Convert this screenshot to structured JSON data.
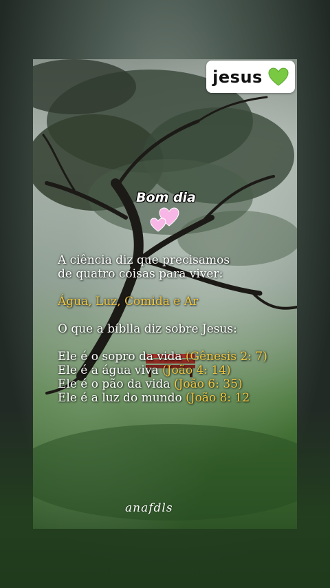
{
  "tag": {
    "label": "jesus",
    "emoji_icon": "green-heart-icon"
  },
  "greeting": {
    "text": "Bom dia",
    "icon": "pink-hearts-icon"
  },
  "intro": {
    "line1": "A ciência diz que precisamos",
    "line2": "de quatro coisas para viver:"
  },
  "essentials": "Água, Luz, Comida e Ar",
  "question": "O que a bíblla diz sobre Jesus:",
  "verses": [
    {
      "text": "Ele é o sopro da vida ",
      "ref": "(Gênesis 2: 7)"
    },
    {
      "text": "Ele é a água viva ",
      "ref": "(João 4: 14)"
    },
    {
      "text": "Ele é o pão da vida ",
      "ref": "(João 6: 35)"
    },
    {
      "text": "Ele é a luz do mundo ",
      "ref": "(João 8: 12"
    }
  ],
  "signature": "anafdls",
  "colors": {
    "accent_gold": "#f0c640",
    "text": "#ffffff",
    "tag_bg": "#ffffff",
    "heart_green": "#7ac943",
    "heart_pink": "#f7b6e6"
  }
}
